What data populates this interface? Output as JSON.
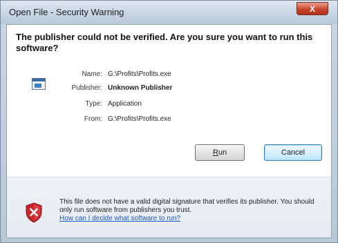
{
  "window": {
    "title": "Open File - Security Warning",
    "close_glyph": "X"
  },
  "main": {
    "headline": "The publisher could not be verified. Are you sure you want to run this software?",
    "file_icon": "application-icon",
    "details": [
      {
        "label": "Name:",
        "value": "G:\\Profits\\Profits.exe",
        "bold": false
      },
      {
        "label": "Publisher:",
        "value": "Unknown Publisher",
        "bold": true
      },
      {
        "label": "Type:",
        "value": "Application",
        "bold": false
      },
      {
        "label": "From:",
        "value": "G:\\Profits\\Profits.exe",
        "bold": false
      }
    ]
  },
  "buttons": {
    "run_prefix": "",
    "run_accel": "R",
    "run_suffix": "un",
    "cancel": "Cancel"
  },
  "footer": {
    "icon": "security-shield-icon",
    "text": "This file does not have a valid digital signature that verifies its publisher. You should only run software from publishers you trust.",
    "link": "How can I decide what software to run?"
  },
  "colors": {
    "titlebar": "#c7d5e3",
    "close_button": "#c8442c",
    "link": "#1a57c4",
    "shield_red": "#c8262c"
  }
}
